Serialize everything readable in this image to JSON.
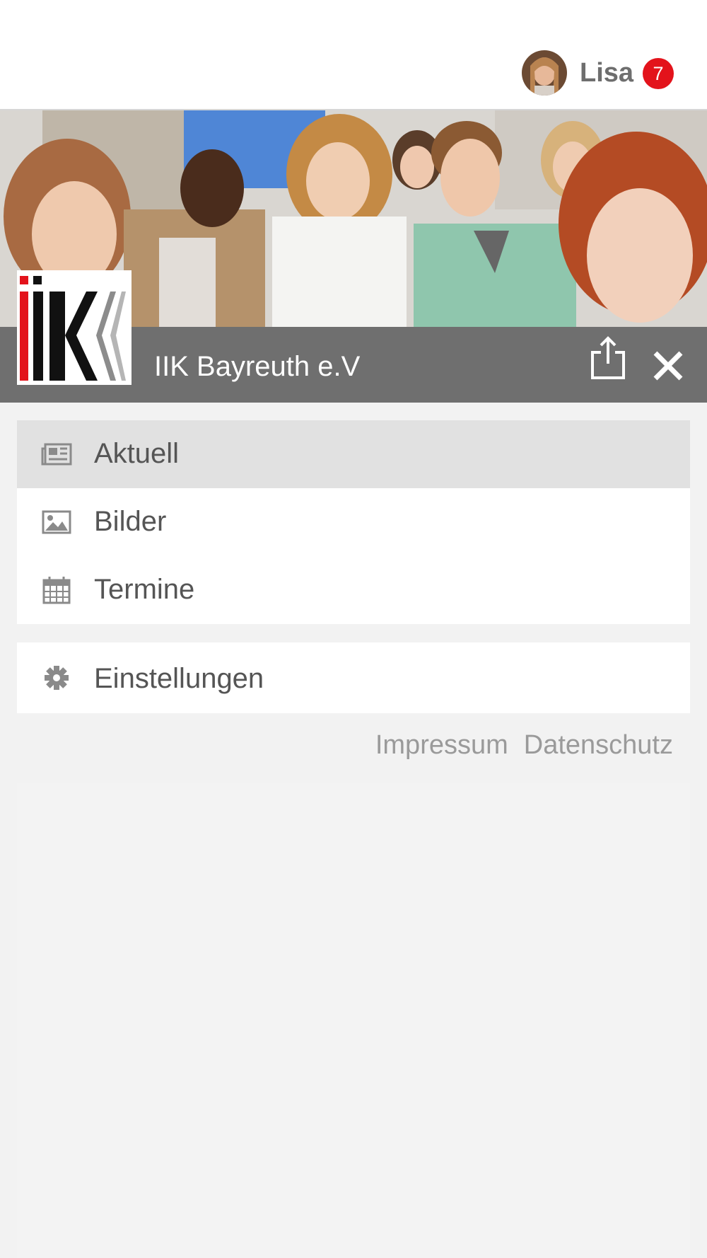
{
  "header": {
    "user_name": "Lisa",
    "notification_count": "7",
    "badge_color": "#e3131b"
  },
  "title_bar": {
    "title": "IIK Bayreuth e.V",
    "background_color": "#6f6f6f"
  },
  "menu": {
    "main_items": [
      {
        "label": "Aktuell",
        "icon": "newspaper-icon",
        "active": true
      },
      {
        "label": "Bilder",
        "icon": "image-icon",
        "active": false
      },
      {
        "label": "Termine",
        "icon": "calendar-icon",
        "active": false
      }
    ],
    "settings_item": {
      "label": "Einstellungen",
      "icon": "gear-icon"
    }
  },
  "footer": {
    "impressum": "Impressum",
    "datenschutz": "Datenschutz"
  }
}
